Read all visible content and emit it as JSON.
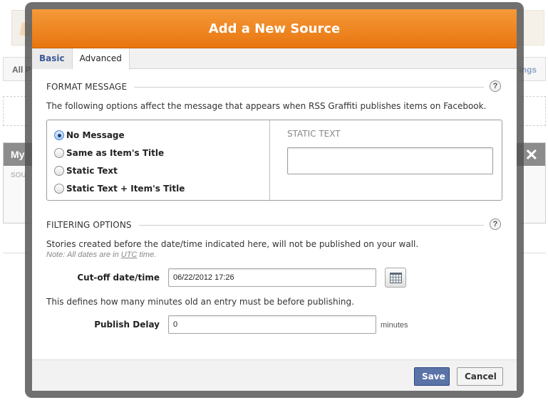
{
  "background": {
    "tab_left": "All P",
    "tab_right": "ings",
    "panel_title": "My",
    "panel_close": "✕",
    "panel_sub": "SOU"
  },
  "modal": {
    "title": "Add a New Source",
    "tabs": [
      {
        "label": "Basic",
        "active": false
      },
      {
        "label": "Advanced",
        "active": true
      }
    ]
  },
  "format_message": {
    "heading": "FORMAT MESSAGE",
    "help": "?",
    "description": "The following options affect the message that appears when RSS Graffiti publishes items on Facebook.",
    "options": [
      {
        "label": "No Message",
        "checked": true
      },
      {
        "label": "Same as Item's Title",
        "checked": false
      },
      {
        "label": "Static Text",
        "checked": false
      },
      {
        "label": "Static Text + Item's Title",
        "checked": false
      }
    ],
    "static_text_label": "STATIC TEXT",
    "static_text_value": ""
  },
  "filtering": {
    "heading": "FILTERING OPTIONS",
    "help": "?",
    "description": "Stories created before the date/time indicated here, will not be published on your wall.",
    "note_prefix": "Note: All dates are in ",
    "note_utc": "UTC",
    "note_suffix": " time.",
    "cutoff_label": "Cut-off date/time",
    "cutoff_value": "06/22/2012 17:26",
    "delay_description": "This defines how many minutes old an entry must be before publishing.",
    "delay_label": "Publish Delay",
    "delay_value": "0",
    "delay_unit": "minutes"
  },
  "footer": {
    "save_label": "Save",
    "cancel_label": "Cancel"
  },
  "colors": {
    "header_orange": "#e8750f",
    "save_blue": "#5b74a8",
    "tab_active_text": "#3b5998"
  }
}
